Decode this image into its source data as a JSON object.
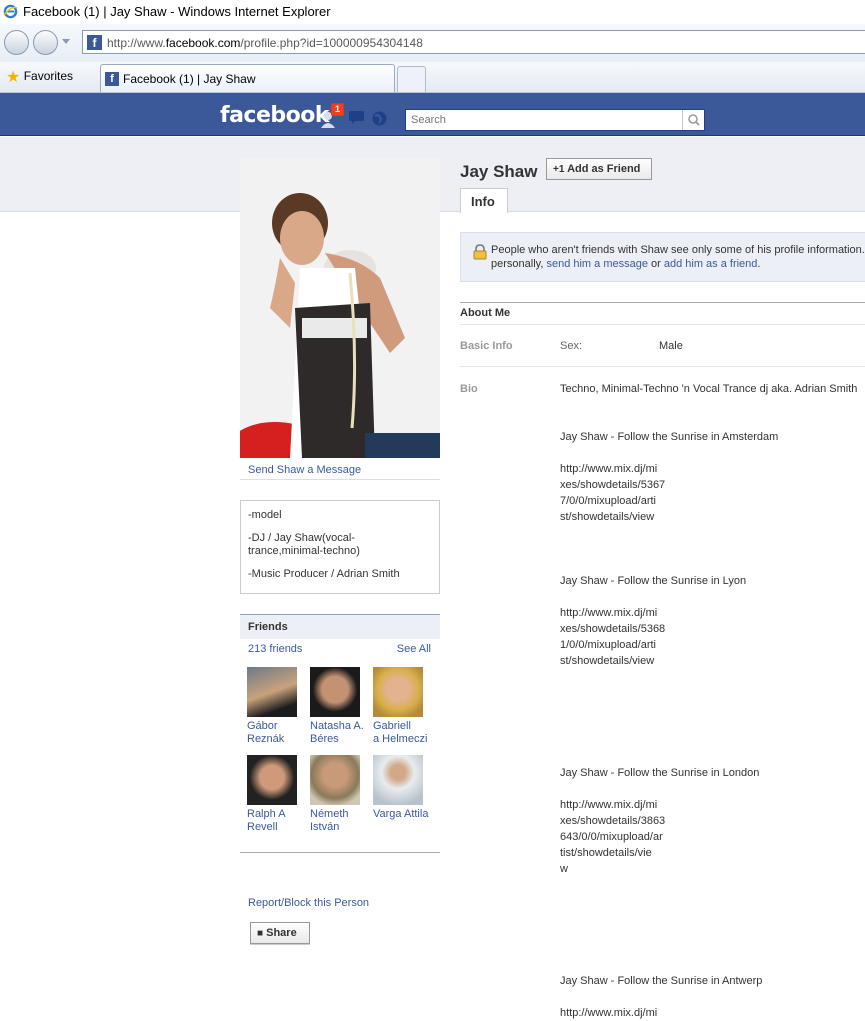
{
  "window": {
    "title": "Facebook (1) | Jay Shaw - Windows Internet Explorer",
    "url_prefix": "http://www.",
    "url_domain": "facebook.com",
    "url_suffix": "/profile.php?id=100000954304148",
    "favorites_label": "Favorites",
    "tab_title": "Facebook (1) | Jay Shaw"
  },
  "fb_header": {
    "logo": "facebook",
    "notification_count": "1",
    "search_placeholder": "Search",
    "icons": [
      "friend-requests-icon",
      "messages-icon",
      "notifications-globe-icon",
      "search-magnifier-icon"
    ]
  },
  "colors": {
    "brand_blue": "#3b5998",
    "badge_red": "#f03d25",
    "link": "#3b5998"
  },
  "left": {
    "send_message": "Send Shaw a Message",
    "bio_lines": [
      "-model",
      "-DJ / Jay Shaw(vocal-trance,minimal-techno)",
      "-Music Producer / Adrian Smith"
    ],
    "friends": {
      "title": "Friends",
      "count": "213 friends",
      "see_all": "See All",
      "list": [
        {
          "line1": "Gábor",
          "line2": "Reznák"
        },
        {
          "line1": "Natasha A.",
          "line2": "Béres"
        },
        {
          "line1": "Gabriell",
          "line2": "a Helmeczi"
        },
        {
          "line1": "Ralph A",
          "line2": "Revell"
        },
        {
          "line1": "Németh",
          "line2": "István"
        },
        {
          "line1": "Varga Attila",
          "line2": ""
        }
      ]
    },
    "report": "Report/Block this Person",
    "share": "Share"
  },
  "profile": {
    "name": "Jay Shaw",
    "add_friend": "Add as Friend",
    "tab_info": "Info",
    "notice_line1": "People who aren't friends with Shaw see only some of his profile information. I",
    "notice_pre": "personally,",
    "notice_link1": "send him a message",
    "notice_or": "or",
    "notice_link2": "add him as a friend",
    "notice_end": ".",
    "about_header": "About Me",
    "basic_info_label": "Basic Info",
    "sex_label": "Sex:",
    "sex_value": "Male",
    "bio_label": "Bio",
    "bio": [
      "Techno, Minimal-Techno 'n Vocal Trance dj aka. Adrian Smith",
      "Jay Shaw - Follow the Sunrise in Amsterdam",
      "http://www.mix.dj/mi",
      "xes/showdetails/5367",
      "7/0/0/mixupload/arti",
      "st/showdetails/view",
      "Jay Shaw - Follow the Sunrise in Lyon",
      "http://www.mix.dj/mi",
      "xes/showdetails/5368",
      "1/0/0/mixupload/arti",
      "st/showdetails/view",
      "Jay Shaw - Follow the Sunrise in London",
      "http://www.mix.dj/mi",
      "xes/showdetails/3863",
      "643/0/0/mixupload/ar",
      "tist/showdetails/vie",
      "w",
      "Jay Shaw - Follow the Sunrise in Antwerp",
      "http://www.mix.dj/mi"
    ]
  }
}
